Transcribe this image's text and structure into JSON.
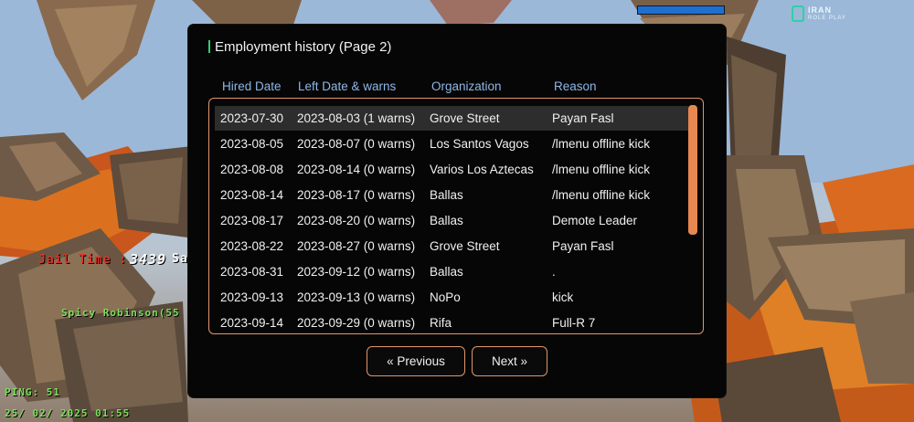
{
  "dialog": {
    "title": "Employment history (Page 2)",
    "columns": [
      "Hired Date",
      "Left Date & warns",
      "Organization",
      "Reason"
    ],
    "rows": [
      {
        "hired": "2023-07-30",
        "left": "2023-08-03 (1 warns)",
        "org": "Grove Street",
        "reason": "Payan Fasl"
      },
      {
        "hired": "2023-08-05",
        "left": "2023-08-07 (0 warns)",
        "org": "Los Santos Vagos",
        "reason": "/lmenu offline kick"
      },
      {
        "hired": "2023-08-08",
        "left": "2023-08-14 (0 warns)",
        "org": "Varios Los Aztecas",
        "reason": "/lmenu offline kick"
      },
      {
        "hired": "2023-08-14",
        "left": "2023-08-17 (0 warns)",
        "org": "Ballas",
        "reason": "/lmenu offline kick"
      },
      {
        "hired": "2023-08-17",
        "left": "2023-08-20 (0 warns)",
        "org": "Ballas",
        "reason": "Demote Leader"
      },
      {
        "hired": "2023-08-22",
        "left": "2023-08-27 (0 warns)",
        "org": "Grove Street",
        "reason": "Payan Fasl"
      },
      {
        "hired": "2023-08-31",
        "left": "2023-09-12 (0 warns)",
        "org": "Ballas",
        "reason": "."
      },
      {
        "hired": "2023-09-13",
        "left": "2023-09-13 (0 warns)",
        "org": "NoPo",
        "reason": "kick"
      },
      {
        "hired": "2023-09-14",
        "left": "2023-09-29 (0 warns)",
        "org": "Rifa",
        "reason": "Full-R 7"
      }
    ],
    "selected_row_index": 0,
    "buttons": {
      "previous": "« Previous",
      "next": "Next »"
    }
  },
  "hud": {
    "jail_label": "Jail Time :",
    "jail_value": "3439",
    "name_partial": "Sa",
    "player_tag": "Spicy Robinson(55",
    "ping": "PING: 51",
    "datetime": "25/ 02/ 2025 01:55",
    "logo_line1": "IRAN",
    "logo_line2": "ROLE PLAY"
  },
  "colors": {
    "accent": "#e1956b",
    "header_text": "#8eb7e8",
    "title_accent": "#2ecf6b",
    "hud_green": "#7be05a",
    "hud_red": "#e0352b"
  },
  "icons": [
    "logo-mark-icon"
  ]
}
